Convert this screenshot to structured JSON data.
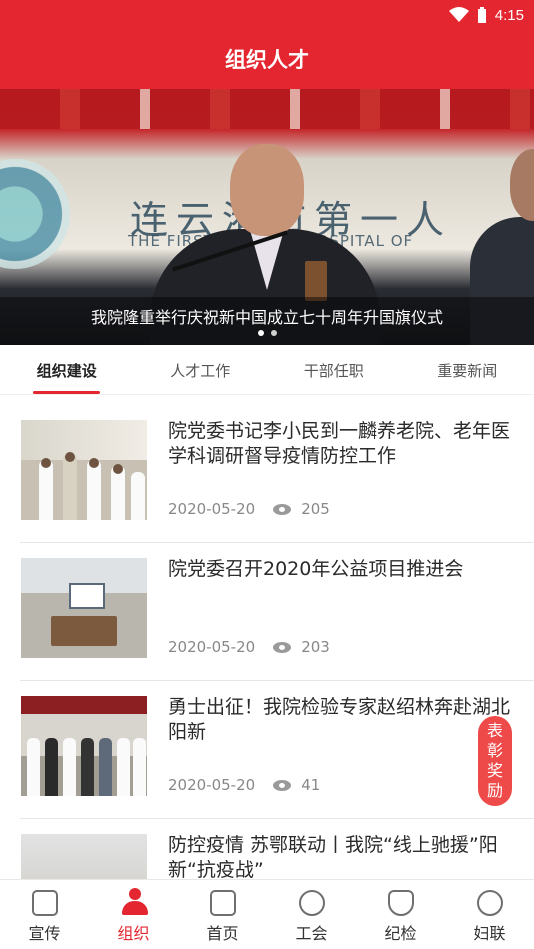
{
  "status_bar": {
    "time": "4:15"
  },
  "header": {
    "title": "组织人才"
  },
  "banner": {
    "caption": "我院隆重举行庆祝新中国成立七十周年升国旗仪式",
    "sign_text": "连云港市第一人",
    "sign_subtext": "THE FIRST PEOPLE'S HOSPITAL OF",
    "slide_count": 2,
    "active_slide": 1
  },
  "tabs": [
    {
      "label": "组织建设",
      "active": true
    },
    {
      "label": "人才工作",
      "active": false
    },
    {
      "label": "干部任职",
      "active": false
    },
    {
      "label": "重要新闻",
      "active": false
    }
  ],
  "news": [
    {
      "title": "院党委书记李小民到一麟养老院、老年医学科调研督导疫情防控工作",
      "date": "2020-05-20",
      "views": "205"
    },
    {
      "title": "院党委召开2020年公益项目推进会",
      "date": "2020-05-20",
      "views": "203"
    },
    {
      "title": "勇士出征！我院检验专家赵绍林奔赴湖北阳新",
      "date": "2020-05-20",
      "views": "41"
    },
    {
      "title": "防控疫情 苏鄂联动丨我院“线上驰援”阳新“抗疫战”",
      "date": "",
      "views": ""
    }
  ],
  "floating_badge": {
    "chars": [
      "表",
      "彰",
      "奖",
      "励"
    ]
  },
  "bottom_nav": [
    {
      "label": "宣传",
      "icon": "tv-icon",
      "active": false
    },
    {
      "label": "组织",
      "icon": "person-icon",
      "active": true
    },
    {
      "label": "首页",
      "icon": "building-icon",
      "active": false
    },
    {
      "label": "工会",
      "icon": "union-emblem-icon",
      "active": false
    },
    {
      "label": "纪检",
      "icon": "shield-icon",
      "active": false
    },
    {
      "label": "妇联",
      "icon": "women-federation-icon",
      "active": false
    }
  ],
  "colors": {
    "brand_red": "#e3262f",
    "badge_red": "#ef4a4a"
  }
}
